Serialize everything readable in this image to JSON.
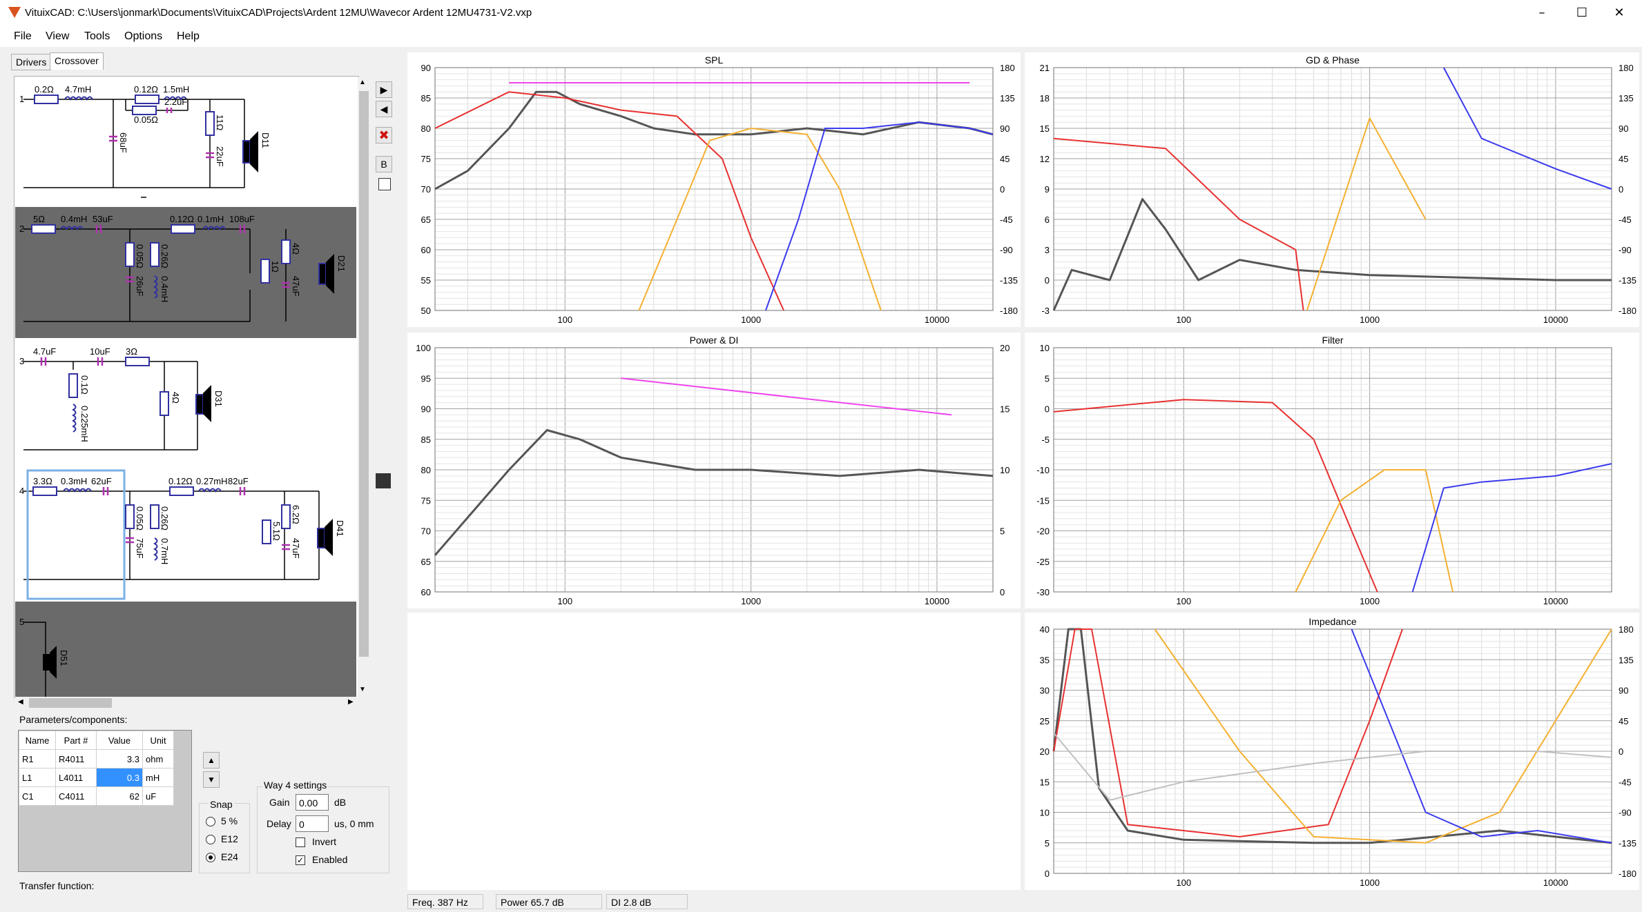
{
  "window": {
    "title": "VituixCAD: C:\\Users\\jonmark\\Documents\\VituixCAD\\Projects\\Ardent 12MU\\Wavecor Ardent 12MU4731-V2.vxp",
    "minimize": "–",
    "maximize": "☐",
    "close": "✕"
  },
  "menu": [
    "File",
    "View",
    "Tools",
    "Options",
    "Help"
  ],
  "tabs": [
    "Drivers",
    "Crossover"
  ],
  "schematic": {
    "way1": {
      "num": "1",
      "labels": [
        "0.2Ω",
        "4.7mH",
        "0.12Ω",
        "1.5mH",
        "0.05Ω",
        "2.2uF",
        "68uF",
        "11Ω",
        "22uF",
        "D11"
      ]
    },
    "way2": {
      "num": "2",
      "labels": [
        "5Ω",
        "0.4mH",
        "53uF",
        "0.12Ω",
        "0.1mH",
        "108uF",
        "0.05Ω",
        "26uF",
        "0.26Ω",
        "0.4mH",
        "1Ω",
        "4Ω",
        "47uF",
        "D21"
      ]
    },
    "way3": {
      "num": "3",
      "labels": [
        "4.7uF",
        "10uF",
        "3Ω",
        "0.1Ω",
        "0.225mH",
        "4Ω",
        "D31"
      ]
    },
    "way4": {
      "num": "4",
      "labels": [
        "3.3Ω",
        "0.3mH",
        "62uF",
        "0.12Ω",
        "0.27mH",
        "82uF",
        "0.05Ω",
        "75uF",
        "0.26Ω",
        "0.7mH",
        "5.1Ω",
        "6.2Ω",
        "47uF",
        "D41"
      ]
    },
    "way5": {
      "num": "5",
      "labels": [
        "D51"
      ]
    }
  },
  "side_buttons": {
    "play": "▶",
    "back": "◀",
    "delete": "✖",
    "b": "B"
  },
  "params": {
    "label": "Parameters/components:",
    "headers": [
      "Name",
      "Part #",
      "Value",
      "Unit"
    ],
    "rows": [
      [
        "R1",
        "R4011",
        "3.3",
        "ohm"
      ],
      [
        "L1",
        "L4011",
        "0.3",
        "mH"
      ],
      [
        "C1",
        "C4011",
        "62",
        "uF"
      ]
    ]
  },
  "snap": {
    "label": "Snap",
    "options": [
      "5 %",
      "E12",
      "E24"
    ],
    "selected": "E24"
  },
  "way_settings": {
    "label": "Way 4 settings",
    "gain_label": "Gain",
    "gain": "0.00",
    "gain_unit": "dB",
    "delay_label": "Delay",
    "delay": "0",
    "delay_unit": "us, 0 mm",
    "invert": "Invert",
    "invert_checked": false,
    "enabled": "Enabled",
    "enabled_checked": true
  },
  "transfer_label": "Transfer function:",
  "status": {
    "freq": "Freq.   387 Hz",
    "power": "Power  65.7 dB",
    "di": "DI    2.8 dB"
  },
  "colors": {
    "red": "#e83030",
    "orange": "#f5b030",
    "blue": "#3a3aee",
    "gray": "#555555",
    "lightgray": "#c0c0c0",
    "magenta": "#ee44ee"
  },
  "chart_data": [
    {
      "type": "line",
      "title": "SPL",
      "x_ticks": [
        "100",
        "1000",
        "10000"
      ],
      "y_ticks": [
        "90",
        "85",
        "80",
        "75",
        "70",
        "65",
        "60",
        "55",
        "50"
      ],
      "y2_ticks": [
        "180",
        "135",
        "90",
        "45",
        "0",
        "-45",
        "-90",
        "-135",
        "-180"
      ],
      "xlim": [
        20,
        20000
      ],
      "ylim": [
        50,
        90
      ],
      "series": [
        {
          "color": "gray",
          "x": [
            20,
            30,
            50,
            70,
            90,
            120,
            200,
            300,
            500,
            1000,
            2000,
            4000,
            8000,
            15000,
            20000
          ],
          "y": [
            70,
            73,
            80,
            86,
            86,
            84,
            82,
            80,
            79,
            79,
            80,
            79,
            81,
            80,
            79
          ]
        },
        {
          "color": "red",
          "x": [
            20,
            50,
            100,
            200,
            400,
            700,
            1000,
            1500
          ],
          "y": [
            80,
            86,
            85,
            83,
            82,
            75,
            62,
            50
          ]
        },
        {
          "color": "orange",
          "x": [
            250,
            400,
            600,
            1000,
            2000,
            3000,
            5000
          ],
          "y": [
            50,
            65,
            78,
            80,
            79,
            70,
            50
          ]
        },
        {
          "color": "blue",
          "x": [
            1200,
            1800,
            2500,
            4000,
            8000,
            15000,
            20000
          ],
          "y": [
            50,
            65,
            80,
            80,
            81,
            80,
            79
          ]
        },
        {
          "color": "magenta",
          "x": [
            50,
            15000
          ],
          "y": [
            87.5,
            87.5
          ]
        }
      ]
    },
    {
      "type": "line",
      "title": "GD & Phase",
      "x_ticks": [
        "100",
        "1000",
        "10000"
      ],
      "y_ticks": [
        "21",
        "18",
        "15",
        "12",
        "9",
        "6",
        "3",
        "0",
        "-3"
      ],
      "y2_ticks": [
        "180",
        "135",
        "90",
        "45",
        "0",
        "-45",
        "-90",
        "-135",
        "-180"
      ],
      "xlim": [
        20,
        20000
      ],
      "ylim": [
        -3,
        21
      ],
      "series": [
        {
          "color": "gray",
          "x": [
            20,
            25,
            40,
            60,
            80,
            120,
            200,
            400,
            1000,
            10000,
            20000
          ],
          "y": [
            -3,
            1,
            0,
            8,
            5,
            0,
            2,
            1,
            0.5,
            0,
            0
          ]
        },
        {
          "color": "red",
          "x": [
            20,
            80,
            200,
            400,
            440
          ],
          "y": [
            14,
            13,
            6,
            3,
            -3
          ]
        },
        {
          "color": "orange",
          "x": [
            460,
            1000,
            2000
          ],
          "y": [
            -3,
            16,
            6
          ]
        },
        {
          "color": "blue",
          "x": [
            2500,
            4000,
            10000,
            20000
          ],
          "y": [
            21,
            14,
            11,
            9
          ]
        }
      ]
    },
    {
      "type": "line",
      "title": "Power & DI",
      "x_ticks": [
        "100",
        "1000",
        "10000"
      ],
      "y_ticks": [
        "100",
        "95",
        "90",
        "85",
        "80",
        "75",
        "70",
        "65",
        "60"
      ],
      "y2_ticks": [
        "20",
        "15",
        "10",
        "5",
        "0"
      ],
      "xlim": [
        20,
        20000
      ],
      "ylim": [
        60,
        100
      ],
      "series": [
        {
          "color": "gray",
          "x": [
            20,
            50,
            80,
            120,
            200,
            500,
            1000,
            3000,
            8000,
            20000
          ],
          "y": [
            66,
            80,
            86.5,
            85,
            82,
            80,
            80,
            79,
            80,
            79
          ]
        },
        {
          "color": "magenta",
          "x": [
            200,
            12000
          ],
          "y": [
            95,
            89
          ]
        }
      ]
    },
    {
      "type": "line",
      "title": "Filter",
      "x_ticks": [
        "100",
        "1000",
        "10000"
      ],
      "y_ticks": [
        "10",
        "5",
        "0",
        "-5",
        "-10",
        "-15",
        "-20",
        "-25",
        "-30"
      ],
      "xlim": [
        20,
        20000
      ],
      "ylim": [
        -30,
        10
      ],
      "series": [
        {
          "color": "red",
          "x": [
            20,
            100,
            300,
            500,
            800,
            1100
          ],
          "y": [
            -0.5,
            1.5,
            1,
            -5,
            -20,
            -30
          ]
        },
        {
          "color": "orange",
          "x": [
            400,
            700,
            1200,
            2000,
            2800
          ],
          "y": [
            -30,
            -15,
            -10,
            -10,
            -30
          ]
        },
        {
          "color": "blue",
          "x": [
            1700,
            2500,
            4000,
            10000,
            20000
          ],
          "y": [
            -30,
            -13,
            -12,
            -11,
            -9
          ]
        }
      ]
    },
    {
      "type": "line",
      "title": "Impedance",
      "x_ticks": [
        "100",
        "1000",
        "10000"
      ],
      "y_ticks": [
        "40",
        "35",
        "30",
        "25",
        "20",
        "15",
        "10",
        "5",
        "0"
      ],
      "y2_ticks": [
        "180",
        "135",
        "90",
        "45",
        "0",
        "-45",
        "-90",
        "-135",
        "-180"
      ],
      "xlim": [
        20,
        20000
      ],
      "ylim": [
        0,
        40
      ],
      "series": [
        {
          "color": "gray",
          "x": [
            20,
            24,
            28,
            35,
            50,
            100,
            500,
            1000,
            5000,
            20000
          ],
          "y": [
            20,
            40,
            40,
            14,
            7,
            5.5,
            5,
            5,
            7,
            5
          ]
        },
        {
          "color": "red",
          "x": [
            20,
            26,
            32,
            50,
            200,
            600,
            1000,
            1500
          ],
          "y": [
            20,
            40,
            40,
            8,
            6,
            8,
            25,
            40
          ]
        },
        {
          "color": "orange",
          "x": [
            70,
            200,
            500,
            2000,
            5000,
            20000
          ],
          "y": [
            40,
            20,
            6,
            5,
            10,
            40
          ]
        },
        {
          "color": "blue",
          "x": [
            800,
            2000,
            4000,
            8000,
            20000
          ],
          "y": [
            40,
            10,
            6,
            7,
            5
          ]
        },
        {
          "color": "lightgray",
          "x": [
            20,
            40,
            100,
            500,
            2000,
            8000,
            20000
          ],
          "y": [
            23,
            12,
            15,
            18,
            20,
            20,
            19
          ]
        }
      ]
    }
  ]
}
